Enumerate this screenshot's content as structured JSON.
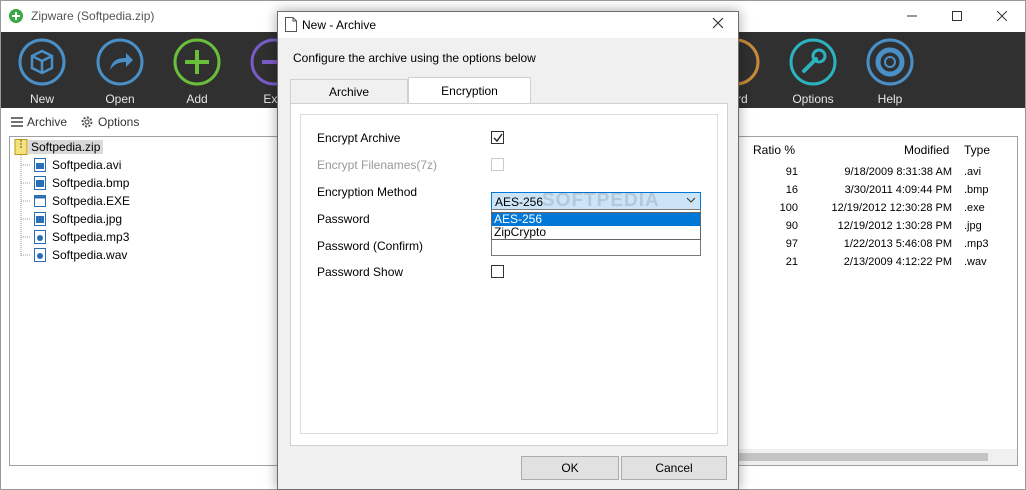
{
  "app": {
    "title": "Zipware (Softpedia.zip)"
  },
  "toolbar": {
    "buttons": [
      {
        "label": "New",
        "color": "#4a90c8"
      },
      {
        "label": "Open",
        "color": "#4a90c8"
      },
      {
        "label": "Add",
        "color": "#6abf3a"
      },
      {
        "label": "Extr",
        "color": "#7a5cc8"
      },
      {
        "label": "vord",
        "color": "#c88a3a"
      },
      {
        "label": "Options",
        "color": "#2bb3c0"
      },
      {
        "label": "Help",
        "color": "#4a90c8"
      }
    ]
  },
  "subbar": {
    "archive_label": "Archive",
    "options_label": "Options"
  },
  "tree": {
    "root": "Softpedia.zip",
    "children": [
      "Softpedia.avi",
      "Softpedia.bmp",
      "Softpedia.EXE",
      "Softpedia.jpg",
      "Softpedia.mp3",
      "Softpedia.wav"
    ]
  },
  "list": {
    "headers": {
      "ratio": "Ratio %",
      "modified": "Modified",
      "type": "Type"
    },
    "rows": [
      {
        "ratio": "91",
        "modified": "9/18/2009 8:31:38 AM",
        "type": ".avi"
      },
      {
        "ratio": "16",
        "modified": "3/30/2011 4:09:44 PM",
        "type": ".bmp"
      },
      {
        "ratio": "100",
        "modified": "12/19/2012 12:30:28 PM",
        "type": ".exe"
      },
      {
        "ratio": "90",
        "modified": "12/19/2012 1:30:28 PM",
        "type": ".jpg"
      },
      {
        "ratio": "97",
        "modified": "1/22/2013 5:46:08 PM",
        "type": ".mp3"
      },
      {
        "ratio": "21",
        "modified": "2/13/2009 4:12:22 PM",
        "type": ".wav"
      }
    ]
  },
  "dialog": {
    "title": "New - Archive",
    "description": "Configure the archive using the options below",
    "tabs": {
      "archive": "Archive",
      "encryption": "Encryption"
    },
    "encrypt_archive_label": "Encrypt Archive",
    "encrypt_archive_checked": true,
    "encrypt_filenames_label": "Encrypt Filenames(7z)",
    "encrypt_filenames_checked": false,
    "encryption_method_label": "Encryption Method",
    "encryption_method_value": "AES-256",
    "encryption_method_options": [
      "AES-256",
      "ZipCrypto"
    ],
    "watermark": "SOFTPEDIA",
    "password_label": "Password",
    "password_value": "",
    "password_confirm_label": "Password (Confirm)",
    "password_confirm_value": "",
    "password_show_label": "Password Show",
    "password_show_checked": false,
    "ok_label": "OK",
    "cancel_label": "Cancel"
  }
}
